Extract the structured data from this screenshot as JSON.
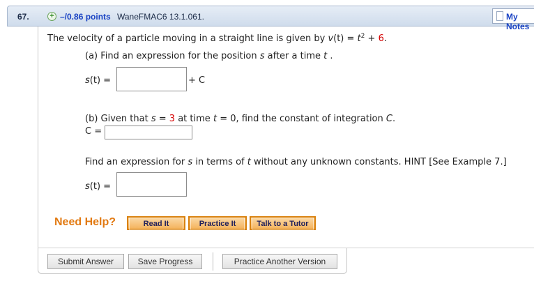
{
  "header": {
    "question_number": "67.",
    "plus_symbol": "+",
    "points": "–/0.86 points",
    "source": "WaneFMAC6 13.1.061.",
    "my_notes": "My Notes"
  },
  "question": {
    "intro": "The velocity of a particle moving in a straight line is given by",
    "v_label": "v",
    "v_arg": "(t) = ",
    "t_var": "t",
    "exp": "2",
    "plus": " + ",
    "const6": "6",
    "period": ".",
    "part_a": {
      "text": "(a) Find an expression for the position",
      "s_var": "s",
      "mid": "after a time",
      "t_var": "t",
      "end": ".",
      "answer_label_s": "s",
      "answer_label_rest": "(t) =",
      "suffix": "+ C",
      "answer_value": ""
    },
    "part_b": {
      "text_start": "(b) Given that",
      "s_var": "s",
      "eq": "=",
      "s_value": "3",
      "at_time": "at time",
      "t_var": "t",
      "t_value": "= 0, find the constant of integration",
      "C_var": "C",
      "end": ".",
      "answer_label": "C =",
      "answer_value": ""
    },
    "part_c": {
      "text_start": "Find an expression for",
      "s_var": "s",
      "in_terms": "in terms of",
      "t_var": "t",
      "text_end": "without any unknown constants. HINT [See Example 7.]",
      "answer_label_s": "s",
      "answer_label_rest": "(t) =",
      "answer_value": ""
    }
  },
  "help": {
    "label": "Need Help?",
    "buttons": [
      "Read It",
      "Practice It",
      "Talk to a Tutor"
    ]
  },
  "actions": {
    "submit": "Submit Answer",
    "save": "Save Progress",
    "another": "Practice Another Version"
  }
}
